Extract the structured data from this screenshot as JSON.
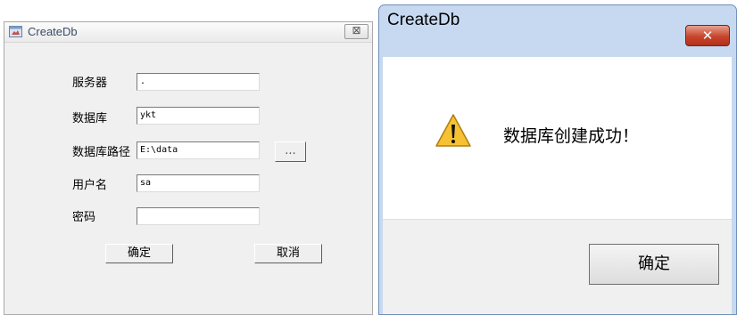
{
  "left_dialog": {
    "title": "CreateDb",
    "close_glyph": "⊠",
    "labels": {
      "server": "服务器",
      "database": "数据库",
      "db_path": "数据库路径",
      "username": "用户名",
      "password": "密码"
    },
    "fields": {
      "server": ".",
      "database": "ykt",
      "db_path": "E:\\data",
      "username": "sa",
      "password": ""
    },
    "browse_label": "...",
    "ok_label": "确定",
    "cancel_label": "取消"
  },
  "right_dialog": {
    "title": "CreateDb",
    "close_glyph": "✕",
    "icon": "warning-icon",
    "message": "数据库创建成功！",
    "ok_label": "确定"
  }
}
